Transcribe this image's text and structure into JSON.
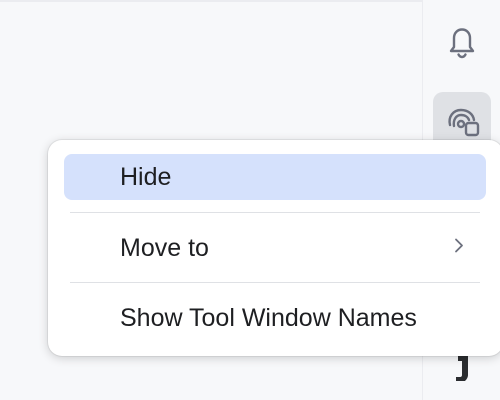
{
  "tool_strip": {
    "buttons": [
      {
        "icon": "bell-icon",
        "active": false
      },
      {
        "icon": "ai-assistant-icon",
        "active": true
      },
      {
        "icon": "partial-tool-icon",
        "active": false
      }
    ]
  },
  "context_menu": {
    "items": [
      {
        "label": "Hide",
        "selected": true,
        "has_submenu": false
      },
      {
        "label": "Move to",
        "selected": false,
        "has_submenu": true
      },
      {
        "label": "Show Tool Window Names",
        "selected": false,
        "has_submenu": false
      }
    ]
  },
  "colors": {
    "selection": "#d5e1fc",
    "menu_background": "#ffffff",
    "strip_background": "#f7f8fa",
    "icon": "#6c707e"
  }
}
